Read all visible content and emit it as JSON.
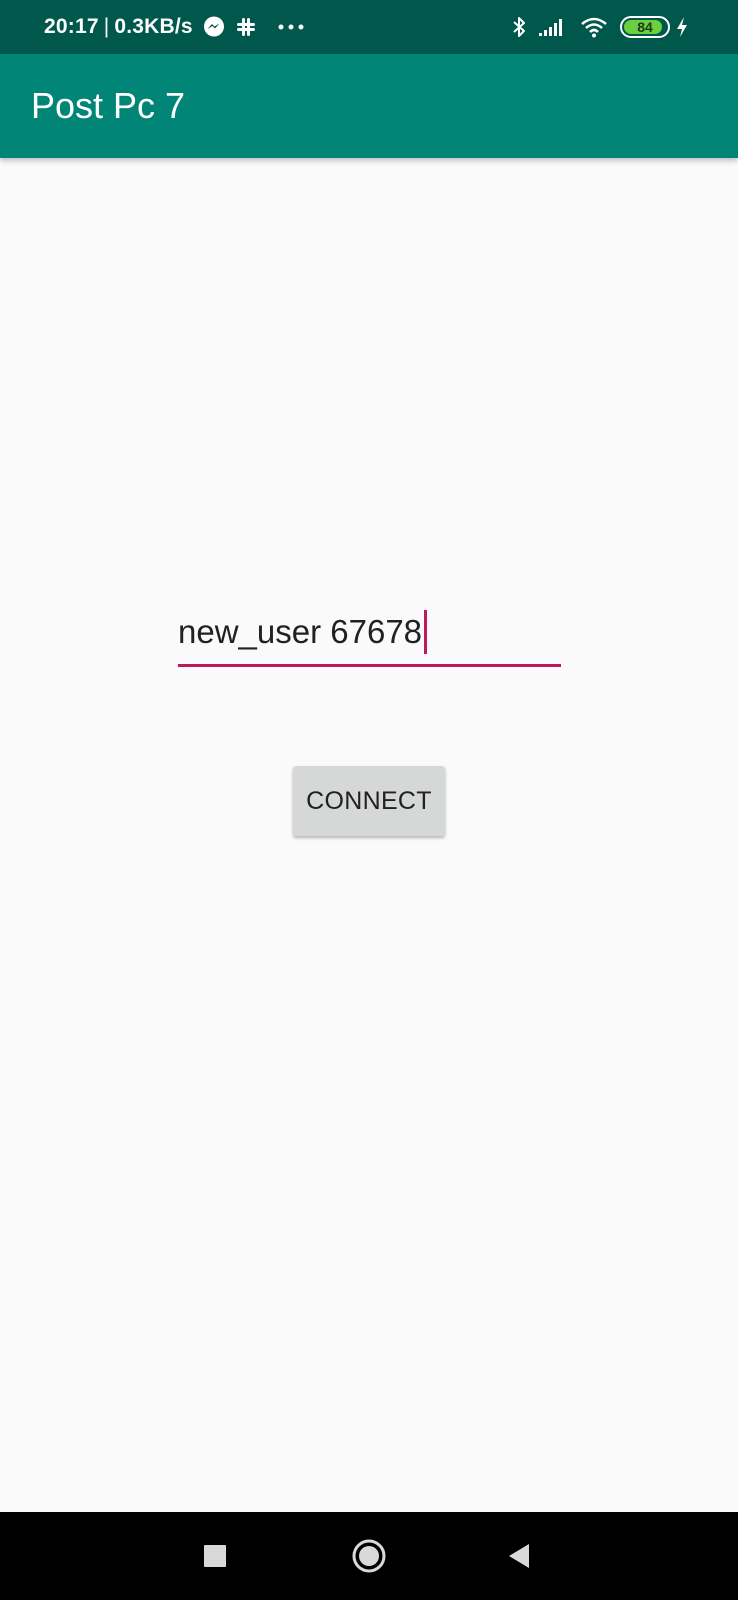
{
  "status_bar": {
    "time": "20:17",
    "separator": "|",
    "network_speed": "0.3KB/s",
    "icons_left": [
      "messenger-icon",
      "slack-icon",
      "more-notifications-icon"
    ],
    "icons_right": [
      "bluetooth-icon",
      "cellular-signal-icon",
      "wifi-icon",
      "battery-icon",
      "charging-icon"
    ],
    "battery_level": "84",
    "battery_color": "#6ccf3e"
  },
  "app_bar": {
    "title": "Post Pc 7",
    "color": "#008577"
  },
  "form": {
    "username_value": "new_user 67678",
    "accent_color": "#c2185b",
    "connect_label": "CONNECT"
  },
  "nav_bar": {
    "buttons": [
      "recents-icon",
      "home-icon",
      "back-icon"
    ]
  }
}
